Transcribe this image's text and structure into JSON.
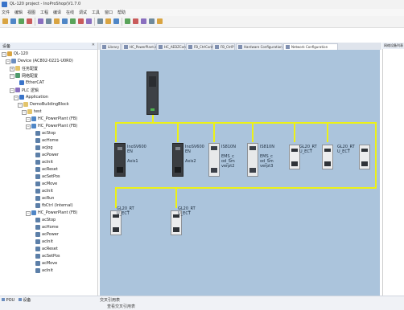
{
  "colors": {
    "canvas_bg": "#abc4dc",
    "bus": "#ecf117",
    "accent": "#3a74c9"
  },
  "window": {
    "title": "QL-120 project - InoProShop(V1.7.0"
  },
  "menu": [
    "文件",
    "编辑",
    "视图",
    "工程",
    "编译",
    "在线",
    "调试",
    "工具",
    "窗口",
    "帮助"
  ],
  "toolbar": {
    "buttons": [
      "new-icon",
      "open-icon",
      "save-icon",
      "print-icon",
      "undo-icon",
      "redo-icon",
      "cut-icon",
      "copy-icon",
      "paste-icon",
      "delete-icon",
      "find-icon",
      "build-icon",
      "login-icon",
      "logout-icon",
      "run-icon",
      "stop-icon",
      "reset-icon",
      "step-icon",
      "breakpoint-icon"
    ]
  },
  "device_panel": {
    "title": "设备",
    "tree": [
      {
        "label": "QL-120",
        "indent": 0,
        "exp": "−",
        "icon": "project"
      },
      {
        "label": "Device (AC802-0221-U0R0)",
        "indent": 1,
        "exp": "−",
        "icon": "device"
      },
      {
        "label": "任务配置",
        "indent": 2,
        "exp": "+",
        "icon": "folder"
      },
      {
        "label": "网络配置",
        "indent": 2,
        "exp": "−",
        "icon": "network"
      },
      {
        "label": "EtherCAT",
        "indent": 3,
        "exp": "",
        "icon": "ecat"
      },
      {
        "label": "PLC 逻辑",
        "indent": 2,
        "exp": "−",
        "icon": "logic"
      },
      {
        "label": "Application",
        "indent": 3,
        "exp": "−",
        "icon": "app"
      },
      {
        "label": "DemoBuildingBlock",
        "indent": 4,
        "exp": "−",
        "icon": "folder"
      },
      {
        "label": "test",
        "indent": 5,
        "exp": "−",
        "icon": "folder"
      },
      {
        "label": "HC_PowerPlant (FB)",
        "indent": 6,
        "exp": "−",
        "icon": "pou"
      },
      {
        "label": "HC_PowerPlant (FB)",
        "indent": 6,
        "exp": "−",
        "icon": "pou"
      },
      {
        "label": "acStop",
        "indent": 7,
        "exp": "",
        "icon": "action"
      },
      {
        "label": "acHome",
        "indent": 7,
        "exp": "",
        "icon": "action"
      },
      {
        "label": "acJog",
        "indent": 7,
        "exp": "",
        "icon": "action"
      },
      {
        "label": "acPower",
        "indent": 7,
        "exp": "",
        "icon": "action"
      },
      {
        "label": "acInit",
        "indent": 7,
        "exp": "",
        "icon": "action"
      },
      {
        "label": "acReset",
        "indent": 7,
        "exp": "",
        "icon": "action"
      },
      {
        "label": "acSetPos",
        "indent": 7,
        "exp": "",
        "icon": "action"
      },
      {
        "label": "acMove",
        "indent": 7,
        "exp": "",
        "icon": "action"
      },
      {
        "label": "acInit",
        "indent": 7,
        "exp": "",
        "icon": "action"
      },
      {
        "label": "acRun",
        "indent": 7,
        "exp": "",
        "icon": "action"
      },
      {
        "label": "fbCtrl (Internal)",
        "indent": 7,
        "exp": "",
        "icon": "action"
      },
      {
        "label": "HC_PowerPlant (FB)",
        "indent": 6,
        "exp": "−",
        "icon": "pou"
      },
      {
        "label": "acStop",
        "indent": 7,
        "exp": "",
        "icon": "action"
      },
      {
        "label": "acHome",
        "indent": 7,
        "exp": "",
        "icon": "action"
      },
      {
        "label": "acPower",
        "indent": 7,
        "exp": "",
        "icon": "action"
      },
      {
        "label": "acInit",
        "indent": 7,
        "exp": "",
        "icon": "action"
      },
      {
        "label": "acReset",
        "indent": 7,
        "exp": "",
        "icon": "action"
      },
      {
        "label": "acSetPos",
        "indent": 7,
        "exp": "",
        "icon": "action"
      },
      {
        "label": "acMove",
        "indent": 7,
        "exp": "",
        "icon": "action"
      },
      {
        "label": "acInit",
        "indent": 7,
        "exp": "",
        "icon": "action"
      }
    ]
  },
  "tabs": [
    {
      "label": "Library"
    },
    {
      "label": "HC_PowerPlant.acInitis"
    },
    {
      "label": "HC_AEDZControl"
    },
    {
      "label": "FB_CtrlControl"
    },
    {
      "label": "FB_CtrlP"
    },
    {
      "label": "Hardware Configuration"
    },
    {
      "label": "Network Configuration",
      "active": true
    }
  ],
  "network": {
    "top_devices": [
      {
        "label": "InoSV600\nEN\n\nAxis1",
        "kind": "dark"
      },
      {
        "label": "InoSV600\nEN\n\nAxis2",
        "kind": "dark"
      },
      {
        "label": "IS810N\n\nEMS_c\nod_Sm\nverpt2",
        "kind": "light"
      },
      {
        "label": "IS810N\n\nEMS_c\nod_Sm\nverpt3",
        "kind": "light"
      },
      {
        "label": "GL20_RT\nU_ECT",
        "kind": "small"
      },
      {
        "label": "GL20_RT\nU_ECT",
        "kind": "small"
      }
    ],
    "bottom_devices": [
      {
        "label": "GL20_RT\nU_ECT",
        "kind": "small"
      },
      {
        "label": "GL20_RT\nU_ECT",
        "kind": "small"
      }
    ]
  },
  "right_panel": {
    "title": "网络设备列表"
  },
  "bottom_panel": {
    "tabs": [
      {
        "label": "POU",
        "icon": "pou-tab-icon"
      },
      {
        "label": "设备",
        "icon": "device-tab-icon"
      }
    ],
    "title": "交叉引用表",
    "content": "查看交叉引用表"
  }
}
